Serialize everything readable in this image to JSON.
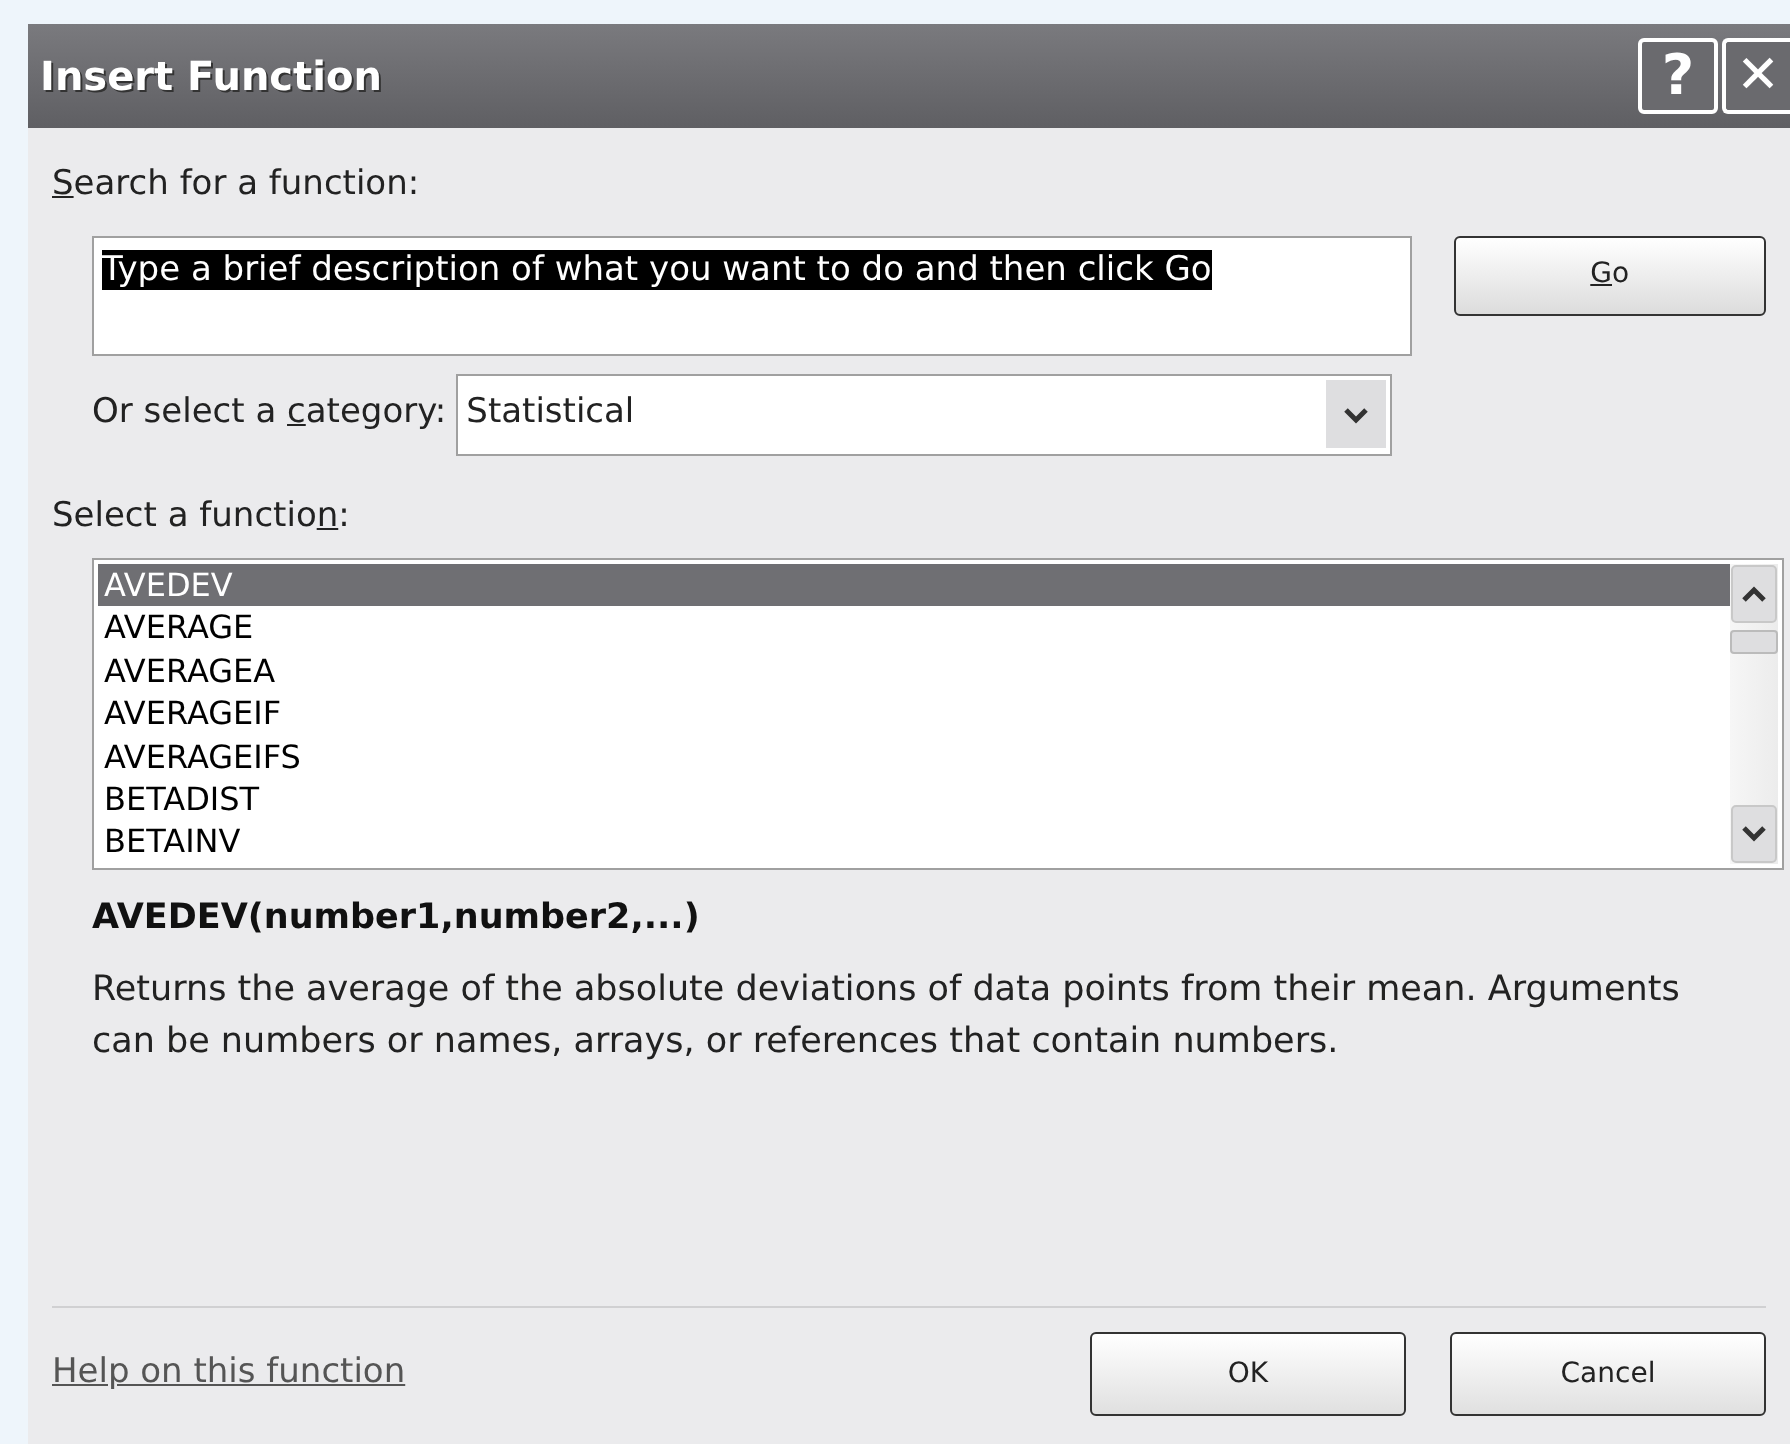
{
  "window": {
    "title": "Insert Function",
    "help_button": "?",
    "close_button": "✕"
  },
  "search": {
    "label": {
      "key": "S",
      "after": "earch for a function:"
    },
    "value": "Type a brief description of what you want to do and then click Go",
    "value_selected": true,
    "go_button": {
      "key": "G",
      "after": "o"
    }
  },
  "category": {
    "label": {
      "before": "Or select a ",
      "key": "c",
      "after": "ategory:"
    },
    "value": "Statistical"
  },
  "function_list": {
    "label": {
      "before": "Select a functio",
      "key": "n",
      "after": ":"
    },
    "items": [
      {
        "label": "AVEDEV",
        "selected": true
      },
      {
        "label": "AVERAGE",
        "selected": false
      },
      {
        "label": "AVERAGEA",
        "selected": false
      },
      {
        "label": "AVERAGEIF",
        "selected": false
      },
      {
        "label": "AVERAGEIFS",
        "selected": false
      },
      {
        "label": "BETADIST",
        "selected": false
      },
      {
        "label": "BETAINV",
        "selected": false
      }
    ]
  },
  "signature": "AVEDEV(number1,number2,...)",
  "description": "Returns the average of the absolute deviations of data points from their mean. Arguments can be numbers or names, arrays, or references that contain numbers.",
  "help_link": "Help on this function",
  "buttons": [
    "OK",
    "Cancel"
  ]
}
